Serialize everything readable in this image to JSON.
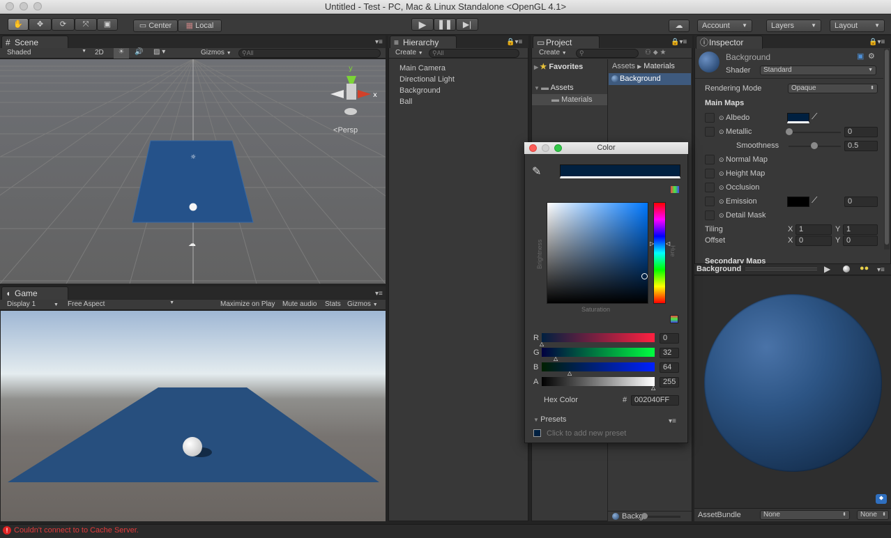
{
  "window": {
    "title": "Untitled - Test - PC, Mac & Linux Standalone <OpenGL 4.1>"
  },
  "toolbar": {
    "center": "Center",
    "local": "Local",
    "account": "Account",
    "layers": "Layers",
    "layout": "Layout",
    "play_icon": "play-icon",
    "pause_icon": "pause-icon",
    "step_icon": "step-icon"
  },
  "scene": {
    "tab": "Scene",
    "shading": "Shaded",
    "mode_2d": "2D",
    "gizmos": "Gizmos",
    "search_placeholder": "All",
    "persp": "Persp",
    "axis_y": "y",
    "axis_x": "x"
  },
  "game": {
    "tab": "Game",
    "display": "Display 1",
    "aspect": "Free Aspect",
    "maximize": "Maximize on Play",
    "mute": "Mute audio",
    "stats": "Stats",
    "gizmos": "Gizmos"
  },
  "hierarchy": {
    "tab": "Hierarchy",
    "create": "Create",
    "search_placeholder": "All",
    "items": [
      "Main Camera",
      "Directional Light",
      "Background",
      "Ball"
    ]
  },
  "project": {
    "tab": "Project",
    "create": "Create",
    "favorites": "Favorites",
    "assets": "Assets",
    "materials": "Materials",
    "breadcrumb": [
      "Assets",
      "Materials"
    ],
    "asset_item": "Background",
    "bottom_item": "Backg"
  },
  "color_picker": {
    "title": "Color",
    "labels": {
      "r": "R",
      "g": "G",
      "b": "B",
      "a": "A"
    },
    "r": "0",
    "g": "32",
    "b": "64",
    "a": "255",
    "hex_label": "Hex Color",
    "hash": "#",
    "hex": "002040FF",
    "saturation": "Saturation",
    "brightness": "Brightness",
    "hue": "Hue",
    "presets": "Presets",
    "add_preset": "Click to add new preset",
    "swatch_color": "#002040"
  },
  "inspector": {
    "tab": "Inspector",
    "name": "Background",
    "shader_label": "Shader",
    "shader": "Standard",
    "rendering_mode_label": "Rendering Mode",
    "rendering_mode": "Opaque",
    "main_maps": "Main Maps",
    "albedo": "Albedo",
    "metallic": "Metallic",
    "metallic_value": "0",
    "smoothness": "Smoothness",
    "smoothness_value": "0.5",
    "normal_map": "Normal Map",
    "height_map": "Height Map",
    "occlusion": "Occlusion",
    "emission": "Emission",
    "emission_value": "0",
    "detail_mask": "Detail Mask",
    "tiling": "Tiling",
    "offset": "Offset",
    "tiling_x": "1",
    "tiling_y": "1",
    "offset_x": "0",
    "offset_y": "0",
    "x_label": "X",
    "y_label": "Y",
    "secondary_maps": "Secondary Maps"
  },
  "preview": {
    "title": "Background",
    "assetbundle_label": "AssetBundle",
    "assetbundle": "None",
    "variant": "None"
  },
  "status": {
    "message": "Couldn't connect to to Cache Server.",
    "error_icon": "error-icon"
  }
}
